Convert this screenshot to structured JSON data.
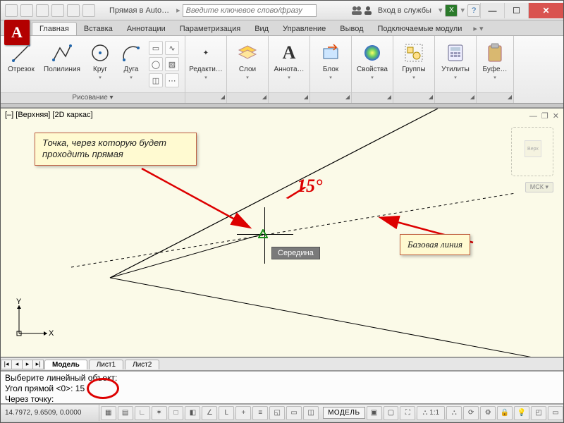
{
  "titlebar": {
    "app_title": "Прямая в Auto…",
    "search_placeholder": "Введите ключевое слово/фразу",
    "login_label": "Вход в службы",
    "app_menu_letter": "A"
  },
  "tabs": {
    "items": [
      {
        "label": "Главная",
        "active": true
      },
      {
        "label": "Вставка"
      },
      {
        "label": "Аннотации"
      },
      {
        "label": "Параметризация"
      },
      {
        "label": "Вид"
      },
      {
        "label": "Управление"
      },
      {
        "label": "Вывод"
      },
      {
        "label": "Подключаемые модули"
      }
    ]
  },
  "ribbon": {
    "panels": [
      {
        "title": "Рисование ▾",
        "items": [
          {
            "label": "Отрезок",
            "icon": "line"
          },
          {
            "label": "Полилиния",
            "icon": "polyline"
          },
          {
            "label": "Круг",
            "icon": "circle"
          },
          {
            "label": "Дуга",
            "icon": "arc"
          }
        ]
      },
      {
        "title": "",
        "items": [
          {
            "label": "Редакти…",
            "icon": "edit"
          }
        ]
      },
      {
        "title": "",
        "items": [
          {
            "label": "Слои",
            "icon": "layers"
          }
        ]
      },
      {
        "title": "",
        "items": [
          {
            "label": "Аннота…",
            "icon": "text"
          }
        ]
      },
      {
        "title": "",
        "items": [
          {
            "label": "Блок",
            "icon": "block"
          }
        ]
      },
      {
        "title": "",
        "items": [
          {
            "label": "Свойства",
            "icon": "props"
          }
        ]
      },
      {
        "title": "",
        "items": [
          {
            "label": "Группы",
            "icon": "groups"
          }
        ]
      },
      {
        "title": "",
        "items": [
          {
            "label": "Утилиты",
            "icon": "utils"
          }
        ]
      },
      {
        "title": "",
        "items": [
          {
            "label": "Буфе…",
            "icon": "clipboard"
          }
        ]
      }
    ]
  },
  "viewport": {
    "label": "[–] [Верхняя] [2D каркас]",
    "ucs_badge": "МСК ▾",
    "cube_face": "Верх"
  },
  "callouts": {
    "point": "Точка, через которую\nбудет проходить прямая",
    "baseline": "Базовая линия",
    "angle": "15°"
  },
  "snap_tooltip": "Середина",
  "sheets": {
    "nav": [
      "|◂",
      "◂",
      "▸",
      "▸|"
    ],
    "items": [
      {
        "label": "Модель",
        "active": true
      },
      {
        "label": "Лист1"
      },
      {
        "label": "Лист2"
      }
    ]
  },
  "command": {
    "line1": "Выберите линейный объект:",
    "line2": "Угол прямой <0>: 15",
    "line3": "Через точку:"
  },
  "status": {
    "coords": "14.7972, 9.6509, 0.0000",
    "model_label": "МОДЕЛЬ"
  }
}
